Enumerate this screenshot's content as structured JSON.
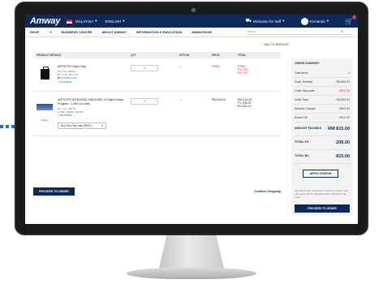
{
  "topbar": {
    "logo": "Amway",
    "country": "MALAYSIA",
    "language": "ENGLISH",
    "greeting": "Welcome for Self",
    "user": "Fernando",
    "cart_count": "2"
  },
  "nav": {
    "items": [
      "SHOP",
      "BUSINESS CENTRE",
      "ABOUT AMWAY",
      "INFORMATION & EDUCATION",
      "AMWAYNOW"
    ],
    "search_placeholder": "Search"
  },
  "wishlist_label": "ADD TO WISHLIST",
  "table": {
    "headers": [
      "PRODUCT DETAILS",
      "QTY",
      "OPTION",
      "PRICE",
      "TOTAL"
    ]
  },
  "rows": [
    {
      "name": "ARTISTRY Paper Bag",
      "item_no": "Item No: 105415",
      "pv": "PV: 0.00 / BV: 0.00",
      "promo": "PROMOTIONS",
      "stock": "IN STOCK",
      "qty": "1",
      "option": "—",
      "price": "FREE",
      "total_lines": [
        "FREE",
        "PV 0.00",
        "BV 0.00"
      ]
    },
    {
      "name": "ARTISTRY INTENSIVE SKINCARE 24 Night Renew Program - 1.5ml x14 vials",
      "item_no": "Item No: 123779",
      "pv": "PV/BV: 208.00 / 815.00",
      "stock": "IN STOCK",
      "qty": "1",
      "option": "—",
      "price": "RM 815.00",
      "total_lines": [
        "RM 815.00",
        "PV 208.00",
        "BV 815.00"
      ],
      "delete": "Delete",
      "plan": "Buy Now Pay Later (BNPL)"
    }
  ],
  "actions": {
    "proceed": "PROCEED TO ORDER",
    "continue": "Continue Shopping"
  },
  "summary": {
    "title": "ORDER SUMMARY",
    "lines": [
      {
        "label": "Total Items",
        "value": "2"
      },
      {
        "label": "Order Subtotal",
        "value": "RM 815.00"
      },
      {
        "label": "Order Discounts",
        "value": "RM 0.00"
      },
      {
        "label": "Order Total",
        "value": "RM 815.00"
      },
      {
        "label": "Delivery Charges",
        "value": "RM 0.00"
      },
      {
        "label": "Round Off",
        "value": "RM 0.00"
      }
    ],
    "payable_label": "AMOUNT PAYABLE",
    "payable_value": "RM 815.00",
    "total_pv_label": "TOTAL PV",
    "total_pv": "208.00",
    "total_bv_label": "TOTAL BV",
    "total_bv": "815.00",
    "coupon": "APPLY COUPON",
    "note": "Final discounts, promotions, delivery charges and other fees will be calculated after submitting this order.",
    "proceed": "PROCEED TO ORDER"
  }
}
